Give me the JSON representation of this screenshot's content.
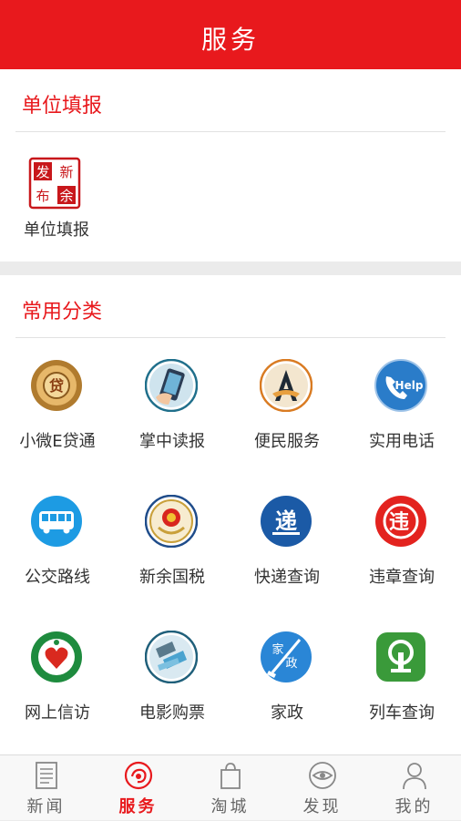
{
  "header": {
    "title": "服务"
  },
  "section_report": {
    "title": "单位填报",
    "items": [
      {
        "label": "单位填报",
        "icon": "xinyu-release-seal-icon"
      }
    ]
  },
  "section_common": {
    "title": "常用分类",
    "items": [
      {
        "label": "小微E贷通",
        "icon": "loan-icon"
      },
      {
        "label": "掌中读报",
        "icon": "tablet-reading-icon"
      },
      {
        "label": "便民服务",
        "icon": "handshake-service-icon"
      },
      {
        "label": "实用电话",
        "icon": "help-phone-icon"
      },
      {
        "label": "公交路线",
        "icon": "bus-icon"
      },
      {
        "label": "新余国税",
        "icon": "tax-emblem-icon"
      },
      {
        "label": "快递查询",
        "icon": "express-delivery-icon"
      },
      {
        "label": "违章查询",
        "icon": "traffic-violation-icon"
      },
      {
        "label": "网上信访",
        "icon": "petition-icon"
      },
      {
        "label": "电影购票",
        "icon": "film-ticket-icon"
      },
      {
        "label": "家政",
        "icon": "housekeeping-icon"
      },
      {
        "label": "列车查询",
        "icon": "train-icon"
      }
    ]
  },
  "tabbar": {
    "tabs": [
      {
        "label": "新闻",
        "icon": "newspaper-icon",
        "active": false
      },
      {
        "label": "服务",
        "icon": "service-icon",
        "active": true
      },
      {
        "label": "淘城",
        "icon": "shopping-bag-icon",
        "active": false
      },
      {
        "label": "发现",
        "icon": "eye-discover-icon",
        "active": false
      },
      {
        "label": "我的",
        "icon": "user-icon",
        "active": false
      }
    ]
  },
  "colors": {
    "brand_red": "#e8191d",
    "text": "#333333",
    "tab_inactive": "#666666"
  }
}
